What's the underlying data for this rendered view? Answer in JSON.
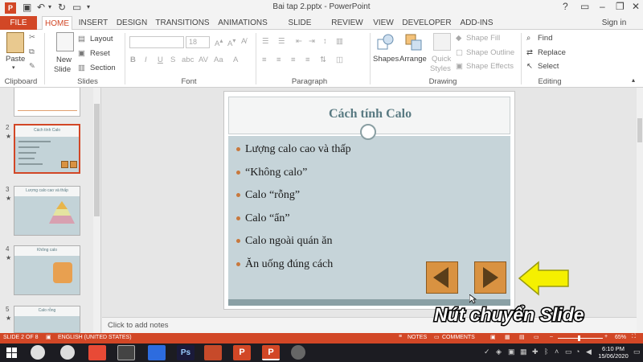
{
  "app": {
    "document_title": "Bai tap 2.pptx - PowerPoint",
    "help": "?",
    "sign_in": "Sign in"
  },
  "tabs": [
    "FILE",
    "HOME",
    "INSERT",
    "DESIGN",
    "TRANSITIONS",
    "ANIMATIONS",
    "SLIDE SHOW",
    "REVIEW",
    "VIEW",
    "DEVELOPER",
    "ADD-INS"
  ],
  "ribbon": {
    "clipboard": {
      "paste": "Paste",
      "label": "Clipboard"
    },
    "slides": {
      "new_slide_1": "New",
      "new_slide_2": "Slide",
      "layout": "Layout",
      "reset": "Reset",
      "section": "Section",
      "label": "Slides"
    },
    "font": {
      "size": "18",
      "label": "Font"
    },
    "paragraph": {
      "label": "Paragraph"
    },
    "drawing": {
      "shapes": "Shapes",
      "arrange": "Arrange",
      "quick_styles_1": "Quick",
      "quick_styles_2": "Styles",
      "shape_fill": "Shape Fill",
      "shape_outline": "Shape Outline",
      "shape_effects": "Shape Effects",
      "label": "Drawing"
    },
    "editing": {
      "find": "Find",
      "replace": "Replace",
      "select": "Select",
      "label": "Editing"
    }
  },
  "thumbnails": [
    {
      "number": "2",
      "star": "★",
      "title": "Cách tính Calo"
    },
    {
      "number": "3",
      "star": "★",
      "title": "Lượng calo cao và thấp"
    },
    {
      "number": "4",
      "star": "★",
      "title": "Không calo"
    },
    {
      "number": "5",
      "star": "★",
      "title": "Calo rỗng"
    }
  ],
  "slide": {
    "title": "Cách tính Calo",
    "bullets": [
      "Lượng calo cao và thấp",
      "“Không calo”",
      "Calo “rỗng”",
      "Calo “ẩn”",
      "Calo ngoài quán ăn",
      "Ăn uống đúng cách"
    ]
  },
  "notes": {
    "placeholder": "Click to add notes"
  },
  "caption": "Nút chuyển  Slide",
  "status": {
    "slide": "SLIDE 2 OF 8",
    "language": "ENGLISH (UNITED STATES)",
    "notes": "NOTES",
    "comments": "COMMENTS",
    "zoom": "65%"
  },
  "clock": {
    "time": "6:10 PM",
    "date": "15/06/2020"
  },
  "colors": {
    "accent": "#d24726",
    "slide_body": "#c6d4d9",
    "title_text": "#597a82",
    "nav_button": "#d99241",
    "arrow_yellow": "#f5f000"
  }
}
